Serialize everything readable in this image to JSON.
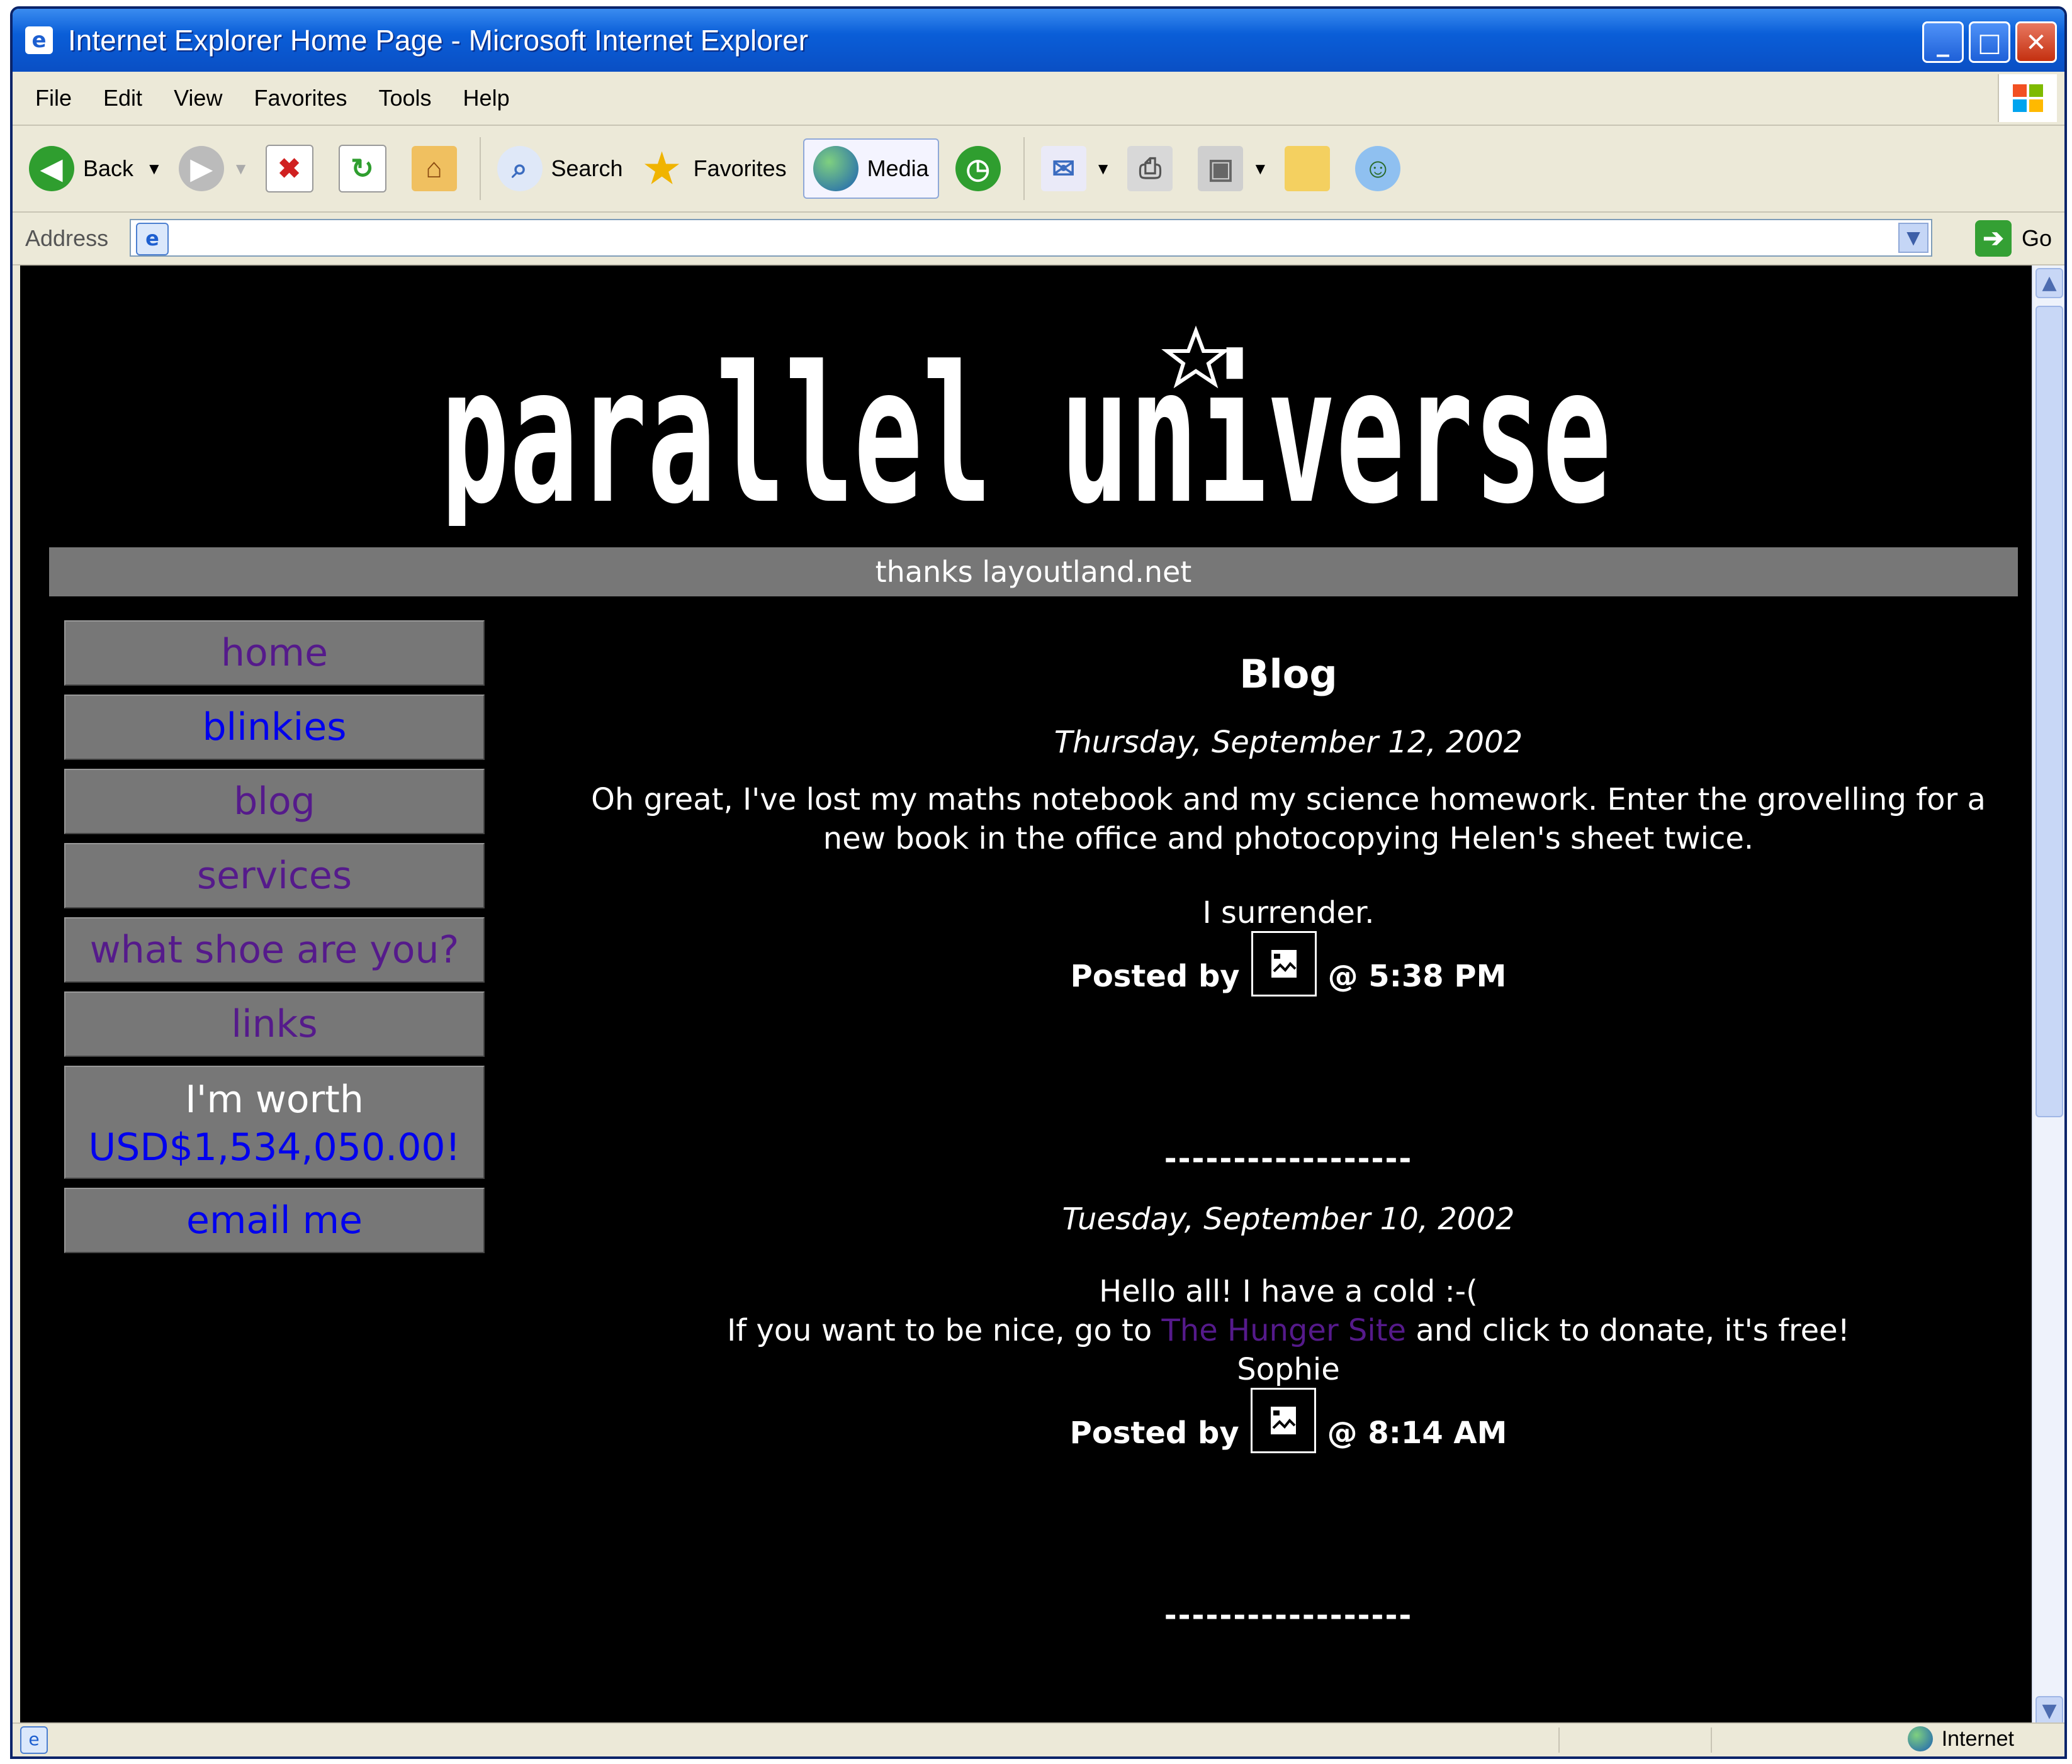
{
  "window": {
    "title": "Internet Explorer Home Page - Microsoft Internet Explorer"
  },
  "menu": [
    "File",
    "Edit",
    "View",
    "Favorites",
    "Tools",
    "Help"
  ],
  "toolbar": {
    "back": "Back",
    "search": "Search",
    "favorites": "Favorites",
    "media": "Media"
  },
  "address": {
    "label": "Address",
    "value": "",
    "go": "Go"
  },
  "page": {
    "subtitle": "thanks layoutland.net",
    "nav": [
      "home",
      "blinkies",
      "blog",
      "services",
      "what shoe are you?",
      "links"
    ],
    "worth_line1": "I'm worth",
    "worth_line2": "USD$1,534,050.00!",
    "email": "email me",
    "blog_title": "Blog",
    "posts": [
      {
        "date": "Thursday, September 12, 2002",
        "text1": "Oh great, I've lost my maths notebook and my science homework. Enter the grovelling for a new book in the office and photocopying Helen's sheet twice.",
        "text2": "I surrender.",
        "posted_by": "Posted by",
        "time": "@ 5:38 PM"
      },
      {
        "date": "Tuesday, September 10, 2002",
        "line1": "Hello all! I have a cold :-(",
        "line2_a": "If you want to be nice, go to",
        "line2_link": "The Hunger Site",
        "line2_b": "and click to donate, it's free!",
        "line3": "Sophie",
        "posted_by": "Posted by",
        "time": "@ 8:14 AM"
      }
    ],
    "divider": "------------------"
  },
  "status": {
    "zone": "Internet"
  },
  "colors": {
    "page_bg": "#000000",
    "bar": "#777777",
    "visited": "#551a8b",
    "link": "#0000ee"
  }
}
